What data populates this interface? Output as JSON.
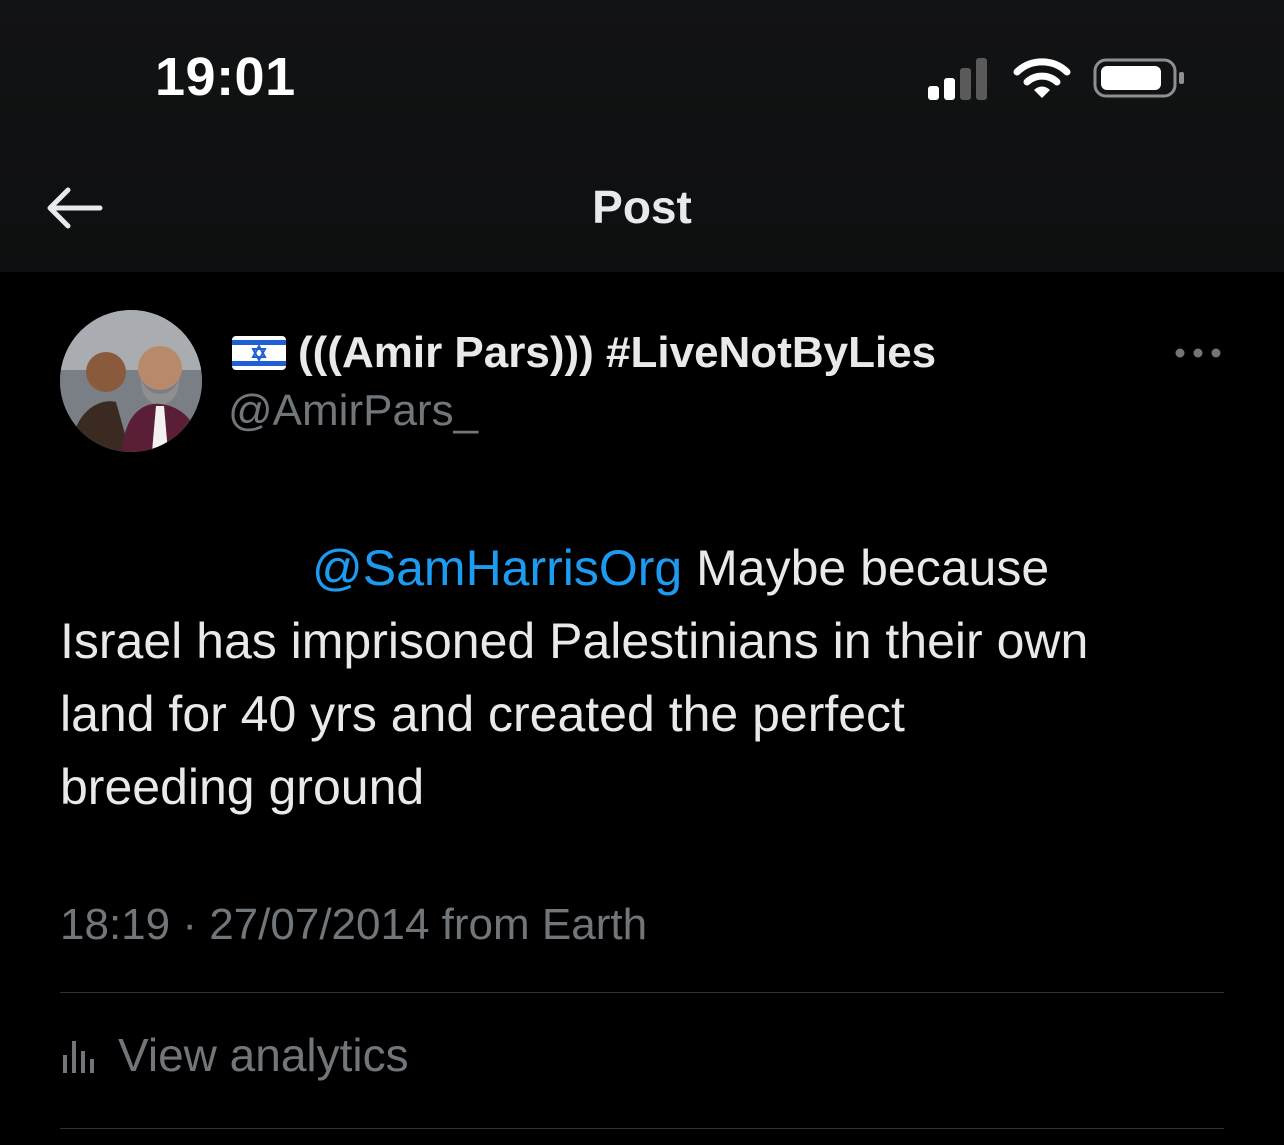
{
  "status_bar": {
    "time": "19:01",
    "signal_icon": "cellular-signal-icon",
    "wifi_icon": "wifi-icon",
    "battery_icon": "battery-icon"
  },
  "header": {
    "back_icon": "back-arrow-icon",
    "title": "Post"
  },
  "post": {
    "avatar_icon": "profile-avatar",
    "flag_icon": "israel-flag-icon",
    "display_name": "(((Amir Pars))) #LiveNotByLies",
    "handle": "@AmirPars_",
    "more_icon": "more-options-icon",
    "mention": "@SamHarrisOrg",
    "text_line1_rest": " Maybe because",
    "text_line2": "Israel has imprisoned Palestinians in their own",
    "text_line3": "land for 40 yrs and created the perfect",
    "text_line4": "breeding ground",
    "meta": "18:19 · 27/07/2014 from Earth",
    "analytics_icon": "analytics-icon",
    "analytics_label": "View analytics"
  },
  "colors": {
    "background": "#000000",
    "text": "#e7e9ea",
    "secondary": "#71767b",
    "link": "#1d9bf0",
    "divider": "#2f3336"
  }
}
